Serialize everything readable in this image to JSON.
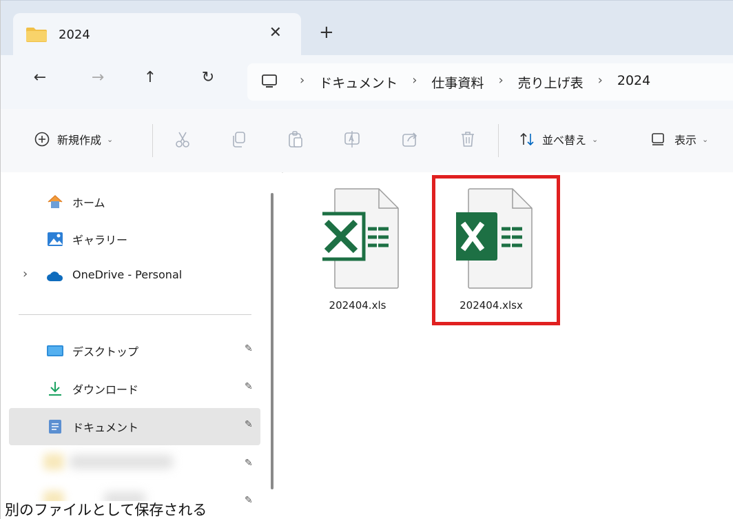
{
  "tab": {
    "title": "2024",
    "close_label": "✕",
    "new_tab_label": "+"
  },
  "nav": {
    "back": "←",
    "forward": "→",
    "up": "↑",
    "refresh": "↻"
  },
  "breadcrumb": {
    "items": [
      "ドキュメント",
      "仕事資料",
      "売り上げ表",
      "2024"
    ],
    "separator": "›"
  },
  "commands": {
    "new_label": "新規作成",
    "sort_label": "並べ替え",
    "view_label": "表示"
  },
  "sidebar": {
    "items": [
      {
        "label": "ホーム"
      },
      {
        "label": "ギャラリー"
      },
      {
        "label": "OneDrive - Personal"
      },
      {
        "label": "デスクトップ"
      },
      {
        "label": "ダウンロード"
      },
      {
        "label": "ドキュメント"
      }
    ],
    "expand_glyph": "›",
    "pin_glyph": "📌"
  },
  "files": [
    {
      "name": "202404.xls",
      "kind": "xls-legacy"
    },
    {
      "name": "202404.xlsx",
      "kind": "xlsx"
    }
  ],
  "caption": "別のファイルとして保存される",
  "colors": {
    "excel_green": "#1d7044",
    "highlight": "#e02020",
    "selected_bg": "#e5e5e5"
  }
}
